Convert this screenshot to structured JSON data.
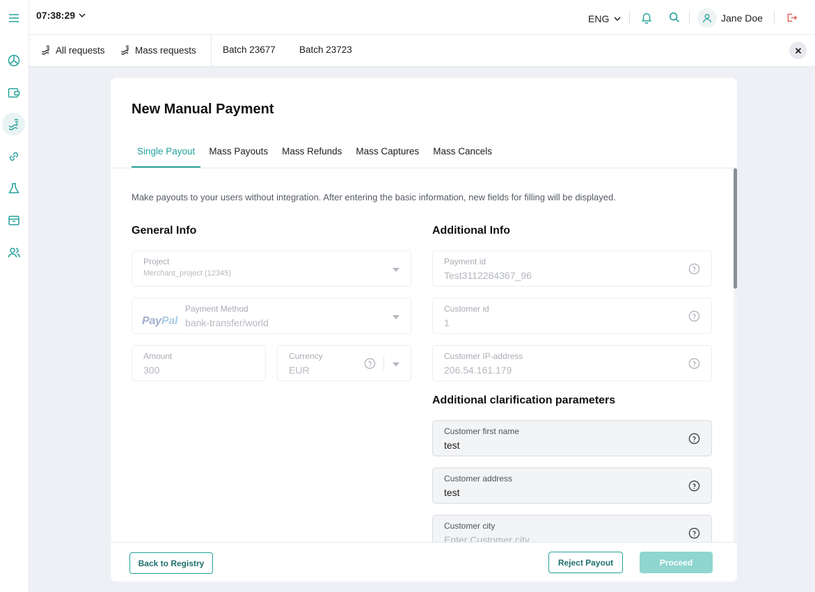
{
  "topbar": {
    "time": "07:38:29",
    "language": "ENG",
    "user_name": "Jane Doe"
  },
  "requests_bar": {
    "items": [
      {
        "label": "All requests"
      },
      {
        "label": "Mass requests"
      },
      {
        "label": "Batch 23677"
      },
      {
        "label": "Batch 23723"
      }
    ]
  },
  "page": {
    "title": "New Manual Payment",
    "tabs": [
      {
        "label": "Single Payout",
        "active": true
      },
      {
        "label": "Mass Payouts",
        "active": false
      },
      {
        "label": "Mass Refunds",
        "active": false
      },
      {
        "label": "Mass Captures",
        "active": false
      },
      {
        "label": "Mass Cancels",
        "active": false
      }
    ],
    "intro": "Make payouts to your users without integration. After entering the basic information, new fields for filling will be displayed."
  },
  "general_info": {
    "title": "General Info",
    "project": {
      "label": "Project",
      "value": "Merchant_project (12345)"
    },
    "payment_method": {
      "label": "Payment Method",
      "brand_left": "Pay",
      "brand_right": "Pal",
      "value": "bank-transfer/world"
    },
    "amount": {
      "label": "Amount",
      "value": "300"
    },
    "currency": {
      "label": "Currency",
      "value": "EUR"
    }
  },
  "additional_info": {
    "title": "Additional Info",
    "payment_id": {
      "label": "Payment id",
      "value": "Test3112284367_96"
    },
    "customer_id": {
      "label": "Customer id",
      "value": "1"
    },
    "customer_ip": {
      "label": "Customer IP-address",
      "value": "206.54.161.179"
    }
  },
  "clarification": {
    "title": "Additional clarification parameters",
    "first_name": {
      "label": "Customer first name",
      "value": "test"
    },
    "address": {
      "label": "Customer address",
      "value": "test"
    },
    "city": {
      "label": "Customer city",
      "placeholder": "Enter Customer city"
    }
  },
  "footer": {
    "back_label": "Back to Registry",
    "reject_label": "Reject Payout",
    "proceed_label": "Proceed"
  },
  "colors": {
    "accent": "#23a19a",
    "proceed_disabled": "#8fd5d0",
    "logout": "#e0574f"
  }
}
